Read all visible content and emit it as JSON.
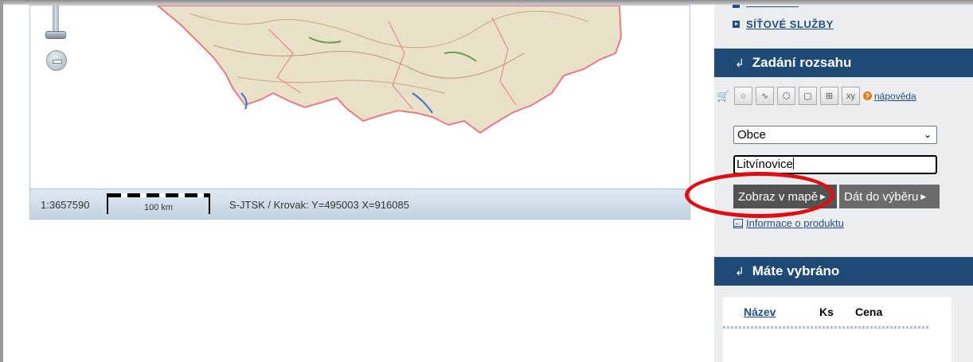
{
  "map": {
    "scale_ratio": "1:3657590",
    "scalebar_label": "100 km",
    "coordinates": "S-JTSK / Krovak: Y=495003 X=916085"
  },
  "sidebar": {
    "link_network": "SÍŤOVÉ SLUŽBY",
    "extent_header": "Zadání rozsahu",
    "help_label": "nápověda",
    "select": {
      "value": "Obce"
    },
    "search": {
      "value": "Litvínovice"
    },
    "show_button": "Zobraz v mapě",
    "add_button": "Dát do výběru",
    "info_link": "Informace o produktu",
    "selected_header": "Máte vybráno",
    "cart": {
      "col_name": "Název",
      "col_count": "Ks",
      "col_price": "Cena"
    }
  },
  "colors": {
    "header_bg": "#1e4a75",
    "link": "#1f4f86",
    "highlight": "#e10d12"
  }
}
